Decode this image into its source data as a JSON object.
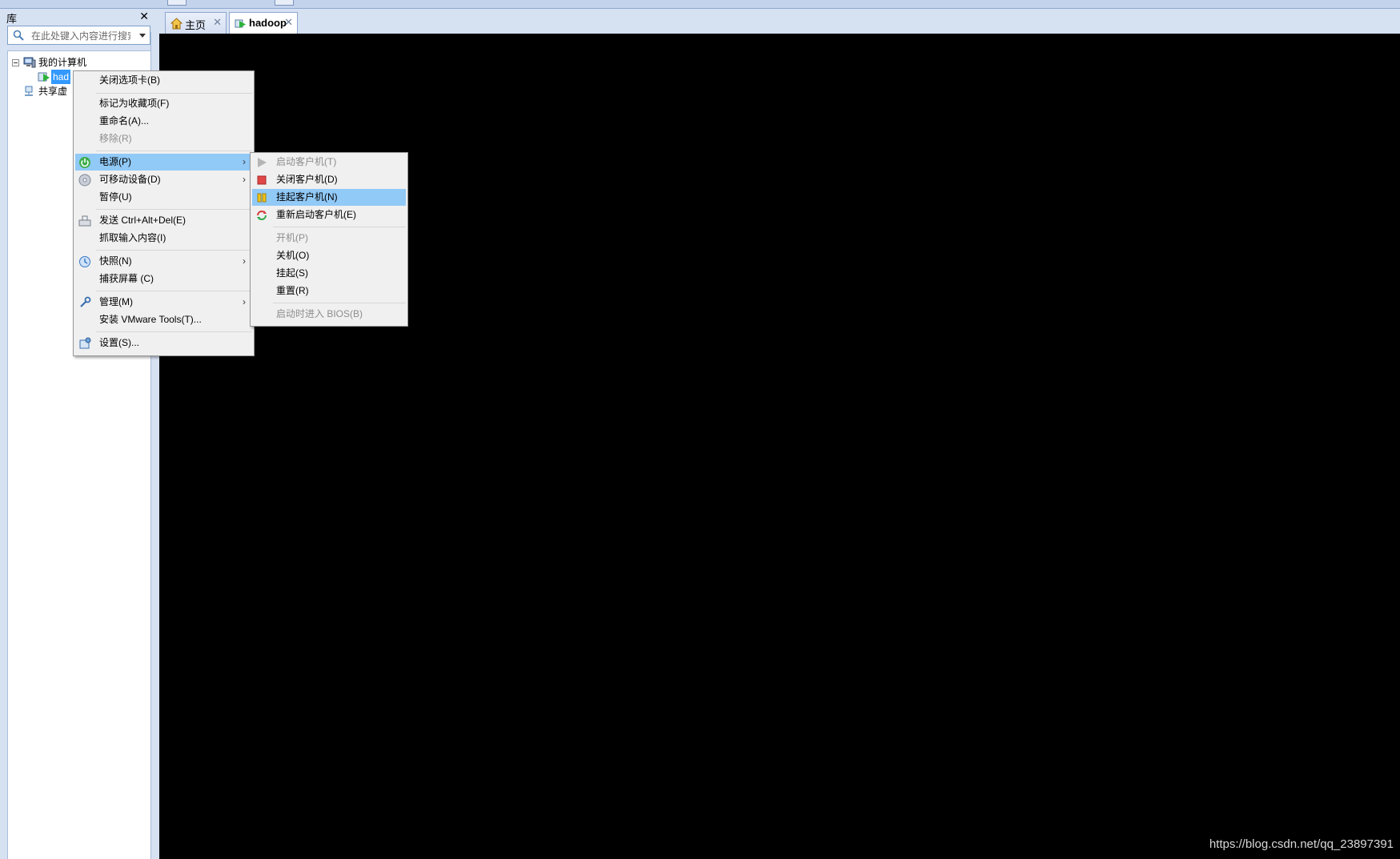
{
  "library": {
    "title": "库",
    "search_placeholder": "在此处键入内容进行搜索",
    "tree": {
      "my_computer": "我的计算机",
      "vm_selected": "had",
      "shared": "共享虚"
    }
  },
  "tabs": [
    {
      "label": "主页",
      "icon": "home-icon",
      "active": false
    },
    {
      "label": "hadoop",
      "icon": "vm-running-icon",
      "active": true
    }
  ],
  "context_menu": {
    "items": {
      "close_tab": "关闭选项卡(B)",
      "favorite": "标记为收藏项(F)",
      "rename": "重命名(A)...",
      "remove": "移除(R)",
      "power": "电源(P)",
      "removable": "可移动设备(D)",
      "pause": "暂停(U)",
      "send_cad": "发送 Ctrl+Alt+Del(E)",
      "grab_input": "抓取输入内容(I)",
      "snapshot": "快照(N)",
      "capture_screen": "捕获屏幕 (C)",
      "manage": "管理(M)",
      "install_tools": "安装 VMware Tools(T)...",
      "settings": "设置(S)..."
    }
  },
  "power_submenu": {
    "items": {
      "start_guest": "启动客户机(T)",
      "shutdown_guest": "关闭客户机(D)",
      "suspend_guest": "挂起客户机(N)",
      "restart_guest": "重新启动客户机(E)",
      "power_on": "开机(P)",
      "power_off": "关机(O)",
      "suspend": "挂起(S)",
      "reset": "重置(R)",
      "bios": "启动时进入 BIOS(B)"
    }
  },
  "watermark": "https://blog.csdn.net/qq_23897391",
  "colors": {
    "highlight": "#91c9f7",
    "selection": "#3399ff",
    "console": "#000000",
    "chrome": "#d6e1f2"
  }
}
